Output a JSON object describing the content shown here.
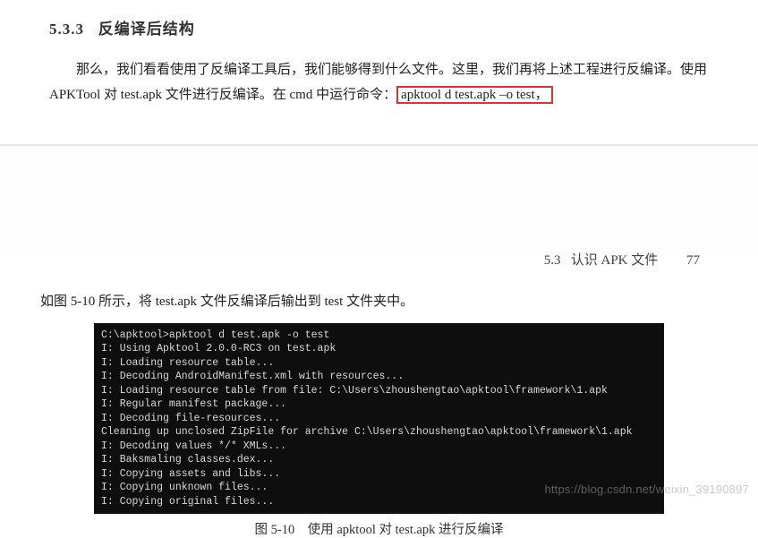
{
  "section": {
    "number": "5.3.3",
    "title": "反编译后结构",
    "para_pre": "那么，我们看看使用了反编译工具后，我们能够得到什么文件。这里，我们再将上述工程进行反编译。使用 APKTool 对 test.apk 文件进行反编译。在 cmd 中运行命令：",
    "command_highlight": "apktool d test.apk –o test，"
  },
  "page_header": {
    "section_ref": "5.3",
    "section_name": "认识 APK 文件",
    "page_num": "77"
  },
  "page2": {
    "para": "如图 5-10 所示，将 test.apk 文件反编译后输出到 test 文件夹中。"
  },
  "terminal_lines": [
    "C:\\apktool>apktool d test.apk -o test",
    "I: Using Apktool 2.0.0-RC3 on test.apk",
    "I: Loading resource table...",
    "I: Decoding AndroidManifest.xml with resources...",
    "I: Loading resource table from file: C:\\Users\\zhoushengtao\\apktool\\framework\\1.apk",
    "I: Regular manifest package...",
    "I: Decoding file-resources...",
    "Cleaning up unclosed ZipFile for archive C:\\Users\\zhoushengtao\\apktool\\framework\\1.apk",
    "I: Decoding values */* XMLs...",
    "I: Baksmaling classes.dex...",
    "I: Copying assets and libs...",
    "I: Copying unknown files...",
    "I: Copying original files..."
  ],
  "figure": {
    "caption": "图 5-10　使用 apktool 对 test.apk 进行反编译"
  },
  "watermark": "https://blog.csdn.net/weixin_39190897"
}
